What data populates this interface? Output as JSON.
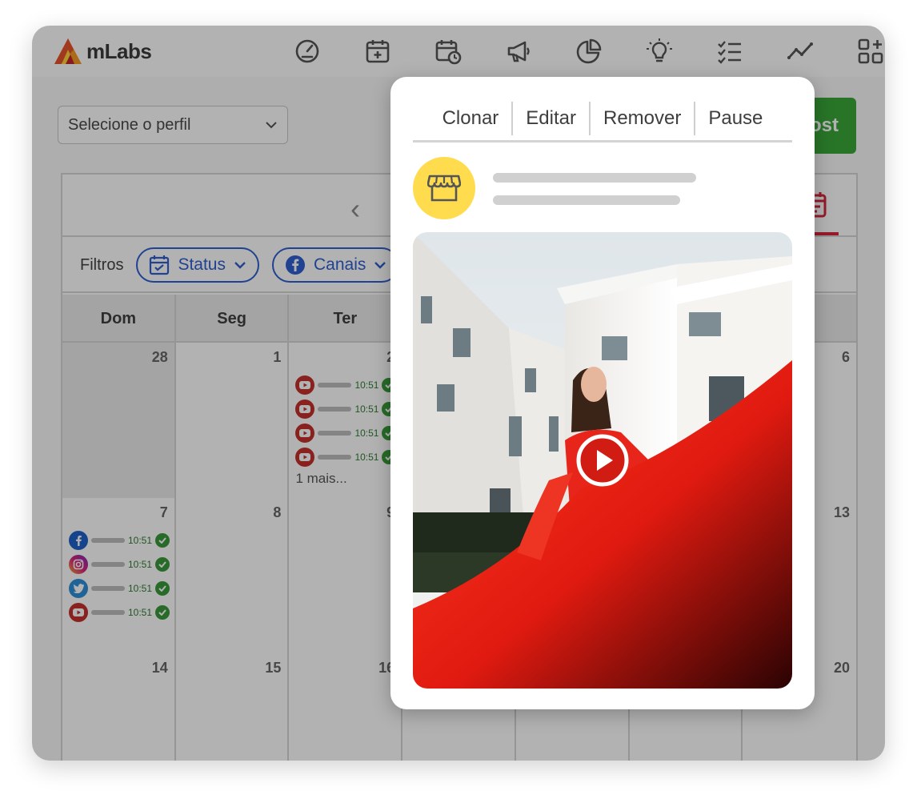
{
  "app": {
    "name": "mLabs"
  },
  "nav": {
    "icons": [
      "dashboard-icon",
      "schedule-add-icon",
      "calendar-clock-icon",
      "megaphone-icon",
      "pie-chart-icon",
      "lightbulb-icon",
      "checklist-icon",
      "trend-line-icon",
      "apps-add-icon"
    ]
  },
  "toolbar": {
    "profile_placeholder": "Selecione o perfil",
    "new_post_label": "ost"
  },
  "filters": {
    "label": "Filtros",
    "status_label": "Status",
    "channels_label": "Canais"
  },
  "calendar": {
    "weekdays": [
      "Dom",
      "Seg",
      "Ter",
      "",
      "",
      "",
      ""
    ],
    "weeks": [
      [
        "28",
        "1",
        "2",
        "",
        "",
        "",
        "6"
      ],
      [
        "7",
        "8",
        "9",
        "",
        "",
        "",
        "13"
      ],
      [
        "14",
        "15",
        "16",
        "",
        "",
        "",
        "20"
      ]
    ],
    "tuesday_posts_time": "10:51",
    "more_label": "1 mais...",
    "sunday_posts_time": "10:51"
  },
  "popup": {
    "actions": [
      "Clonar",
      "Editar",
      "Remover",
      "Pause"
    ]
  },
  "colors": {
    "accent_green": "#3aa83a",
    "filter_blue": "#2f5fd0",
    "tab_red": "#d7263d",
    "avatar_yellow": "#fedc4e"
  }
}
